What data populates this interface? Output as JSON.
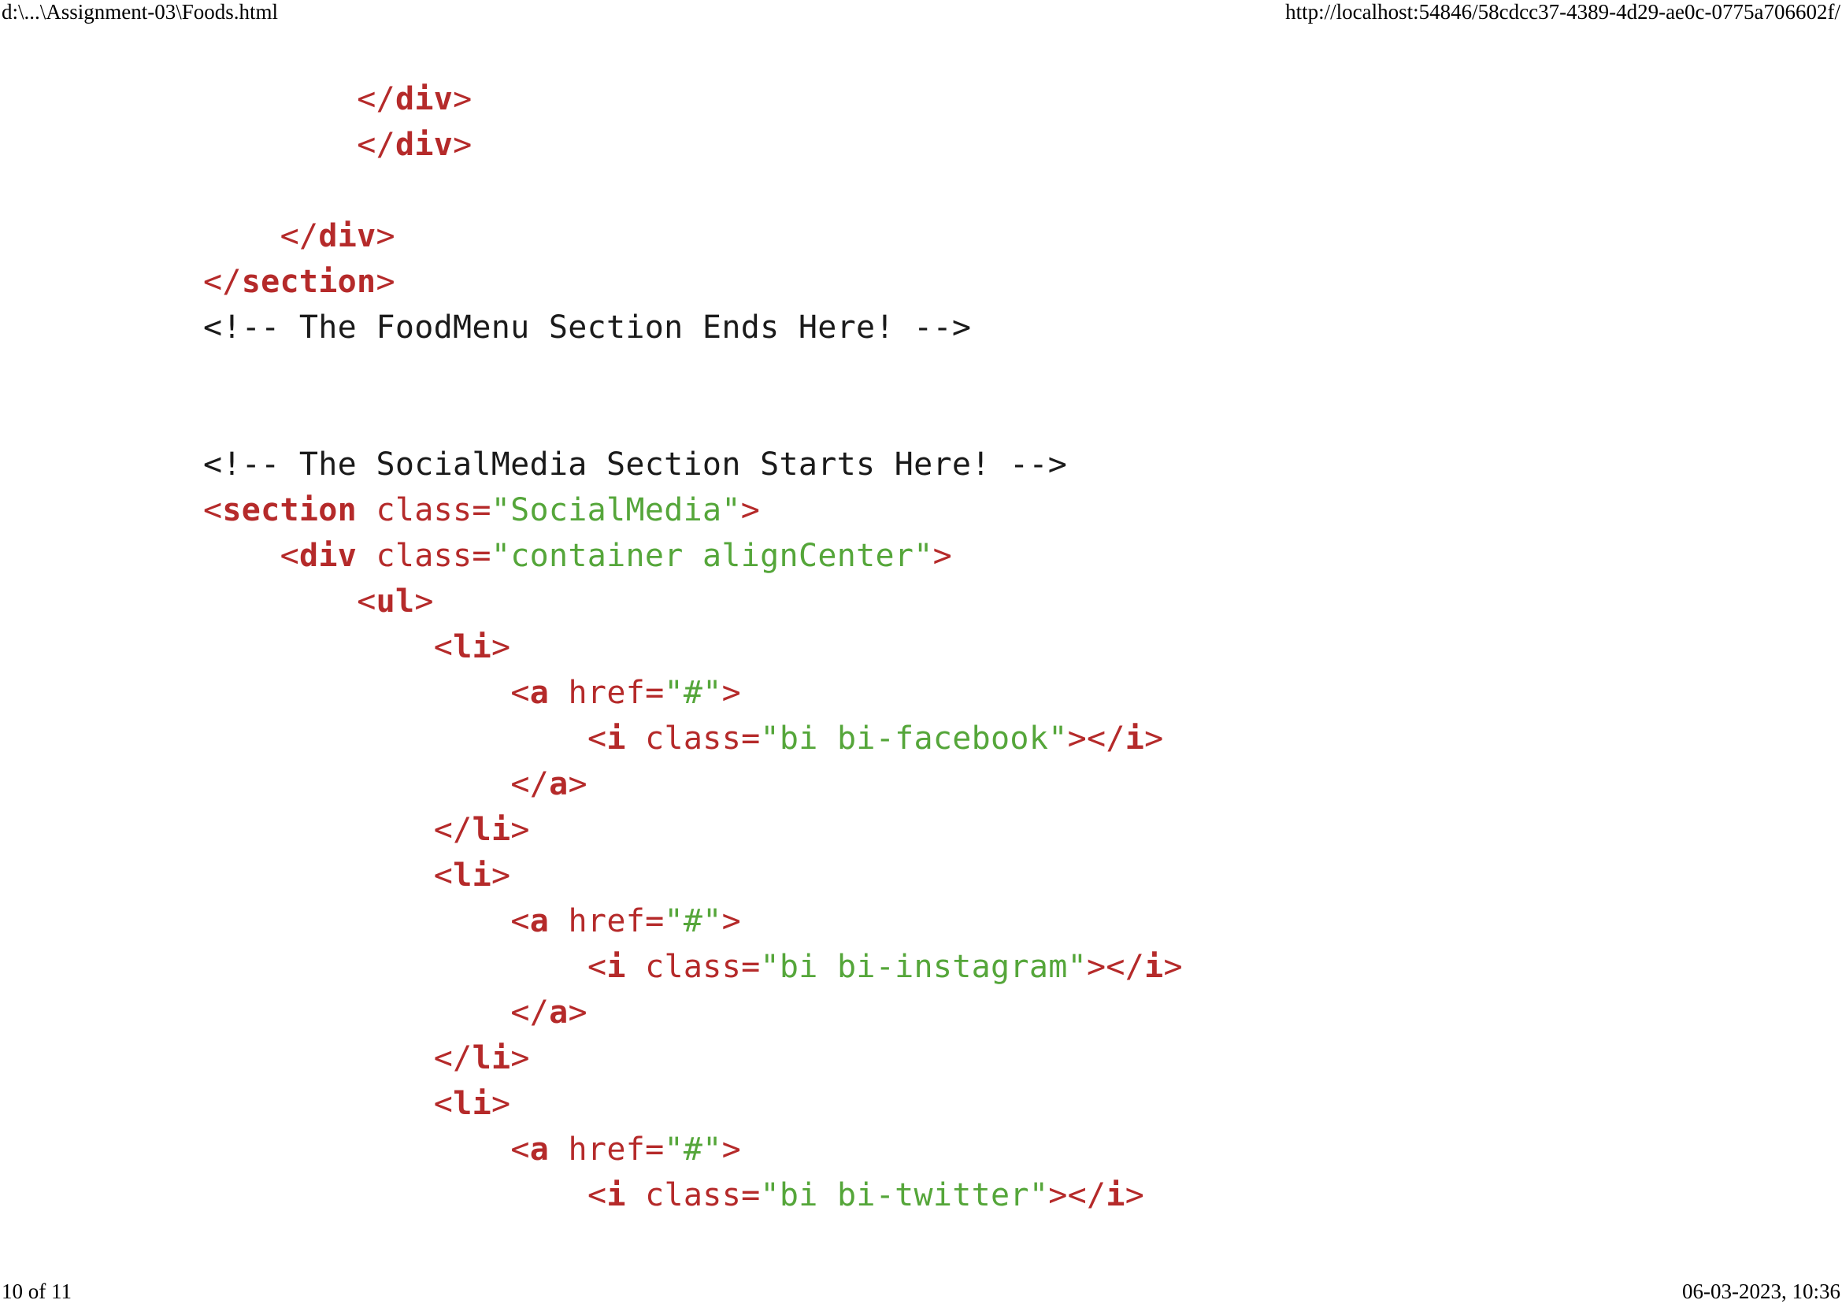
{
  "header": {
    "file_path": "d:\\...\\Assignment-03\\Foods.html",
    "url": "http://localhost:54846/58cdcc37-4389-4d29-ae0c-0775a706602f/"
  },
  "footer": {
    "page_indicator": "10 of 11",
    "timestamp": "06-03-2023, 10:36"
  },
  "colors": {
    "tag": "#b52a2a",
    "attribute_value": "#55a63a",
    "comment": "#1a1a1a"
  },
  "code": {
    "lines": [
      {
        "indent": 12,
        "tokens": [
          {
            "t": "tag",
            "v": "</"
          },
          {
            "t": "tagname",
            "v": "div"
          },
          {
            "t": "tag",
            "v": ">"
          }
        ]
      },
      {
        "indent": 12,
        "tokens": [
          {
            "t": "tag",
            "v": "</"
          },
          {
            "t": "tagname",
            "v": "div"
          },
          {
            "t": "tag",
            "v": ">"
          }
        ]
      },
      {
        "indent": 0,
        "tokens": []
      },
      {
        "indent": 8,
        "tokens": [
          {
            "t": "tag",
            "v": "</"
          },
          {
            "t": "tagname",
            "v": "div"
          },
          {
            "t": "tag",
            "v": ">"
          }
        ]
      },
      {
        "indent": 4,
        "tokens": [
          {
            "t": "tag",
            "v": "</"
          },
          {
            "t": "tagname",
            "v": "section"
          },
          {
            "t": "tag",
            "v": ">"
          }
        ]
      },
      {
        "indent": 4,
        "tokens": [
          {
            "t": "comment",
            "v": "<!-- The FoodMenu Section Ends Here! -->"
          }
        ]
      },
      {
        "indent": 0,
        "tokens": []
      },
      {
        "indent": 0,
        "tokens": []
      },
      {
        "indent": 4,
        "tokens": [
          {
            "t": "comment",
            "v": "<!-- The SocialMedia Section Starts Here! -->"
          }
        ]
      },
      {
        "indent": 4,
        "tokens": [
          {
            "t": "tag",
            "v": "<"
          },
          {
            "t": "tagname",
            "v": "section"
          },
          {
            "t": "attr",
            "v": " class="
          },
          {
            "t": "val",
            "v": "\"SocialMedia\""
          },
          {
            "t": "tag",
            "v": ">"
          }
        ]
      },
      {
        "indent": 8,
        "tokens": [
          {
            "t": "tag",
            "v": "<"
          },
          {
            "t": "tagname",
            "v": "div"
          },
          {
            "t": "attr",
            "v": " class="
          },
          {
            "t": "val",
            "v": "\"container alignCenter\""
          },
          {
            "t": "tag",
            "v": ">"
          }
        ]
      },
      {
        "indent": 12,
        "tokens": [
          {
            "t": "tag",
            "v": "<"
          },
          {
            "t": "tagname",
            "v": "ul"
          },
          {
            "t": "tag",
            "v": ">"
          }
        ]
      },
      {
        "indent": 16,
        "tokens": [
          {
            "t": "tag",
            "v": "<"
          },
          {
            "t": "tagname",
            "v": "li"
          },
          {
            "t": "tag",
            "v": ">"
          }
        ]
      },
      {
        "indent": 20,
        "tokens": [
          {
            "t": "tag",
            "v": "<"
          },
          {
            "t": "tagname",
            "v": "a"
          },
          {
            "t": "attr",
            "v": " href="
          },
          {
            "t": "val",
            "v": "\"#\""
          },
          {
            "t": "tag",
            "v": ">"
          }
        ]
      },
      {
        "indent": 24,
        "tokens": [
          {
            "t": "tag",
            "v": "<"
          },
          {
            "t": "tagname",
            "v": "i"
          },
          {
            "t": "attr",
            "v": " class="
          },
          {
            "t": "val",
            "v": "\"bi bi-facebook\""
          },
          {
            "t": "tag",
            "v": "></"
          },
          {
            "t": "tagname",
            "v": "i"
          },
          {
            "t": "tag",
            "v": ">"
          }
        ]
      },
      {
        "indent": 20,
        "tokens": [
          {
            "t": "tag",
            "v": "</"
          },
          {
            "t": "tagname",
            "v": "a"
          },
          {
            "t": "tag",
            "v": ">"
          }
        ]
      },
      {
        "indent": 16,
        "tokens": [
          {
            "t": "tag",
            "v": "</"
          },
          {
            "t": "tagname",
            "v": "li"
          },
          {
            "t": "tag",
            "v": ">"
          }
        ]
      },
      {
        "indent": 16,
        "tokens": [
          {
            "t": "tag",
            "v": "<"
          },
          {
            "t": "tagname",
            "v": "li"
          },
          {
            "t": "tag",
            "v": ">"
          }
        ]
      },
      {
        "indent": 20,
        "tokens": [
          {
            "t": "tag",
            "v": "<"
          },
          {
            "t": "tagname",
            "v": "a"
          },
          {
            "t": "attr",
            "v": " href="
          },
          {
            "t": "val",
            "v": "\"#\""
          },
          {
            "t": "tag",
            "v": ">"
          }
        ]
      },
      {
        "indent": 24,
        "tokens": [
          {
            "t": "tag",
            "v": "<"
          },
          {
            "t": "tagname",
            "v": "i"
          },
          {
            "t": "attr",
            "v": " class="
          },
          {
            "t": "val",
            "v": "\"bi bi-instagram\""
          },
          {
            "t": "tag",
            "v": "></"
          },
          {
            "t": "tagname",
            "v": "i"
          },
          {
            "t": "tag",
            "v": ">"
          }
        ]
      },
      {
        "indent": 20,
        "tokens": [
          {
            "t": "tag",
            "v": "</"
          },
          {
            "t": "tagname",
            "v": "a"
          },
          {
            "t": "tag",
            "v": ">"
          }
        ]
      },
      {
        "indent": 16,
        "tokens": [
          {
            "t": "tag",
            "v": "</"
          },
          {
            "t": "tagname",
            "v": "li"
          },
          {
            "t": "tag",
            "v": ">"
          }
        ]
      },
      {
        "indent": 16,
        "tokens": [
          {
            "t": "tag",
            "v": "<"
          },
          {
            "t": "tagname",
            "v": "li"
          },
          {
            "t": "tag",
            "v": ">"
          }
        ]
      },
      {
        "indent": 20,
        "tokens": [
          {
            "t": "tag",
            "v": "<"
          },
          {
            "t": "tagname",
            "v": "a"
          },
          {
            "t": "attr",
            "v": " href="
          },
          {
            "t": "val",
            "v": "\"#\""
          },
          {
            "t": "tag",
            "v": ">"
          }
        ]
      },
      {
        "indent": 24,
        "tokens": [
          {
            "t": "tag",
            "v": "<"
          },
          {
            "t": "tagname",
            "v": "i"
          },
          {
            "t": "attr",
            "v": " class="
          },
          {
            "t": "val",
            "v": "\"bi bi-twitter\""
          },
          {
            "t": "tag",
            "v": "></"
          },
          {
            "t": "tagname",
            "v": "i"
          },
          {
            "t": "tag",
            "v": ">"
          }
        ]
      }
    ]
  }
}
